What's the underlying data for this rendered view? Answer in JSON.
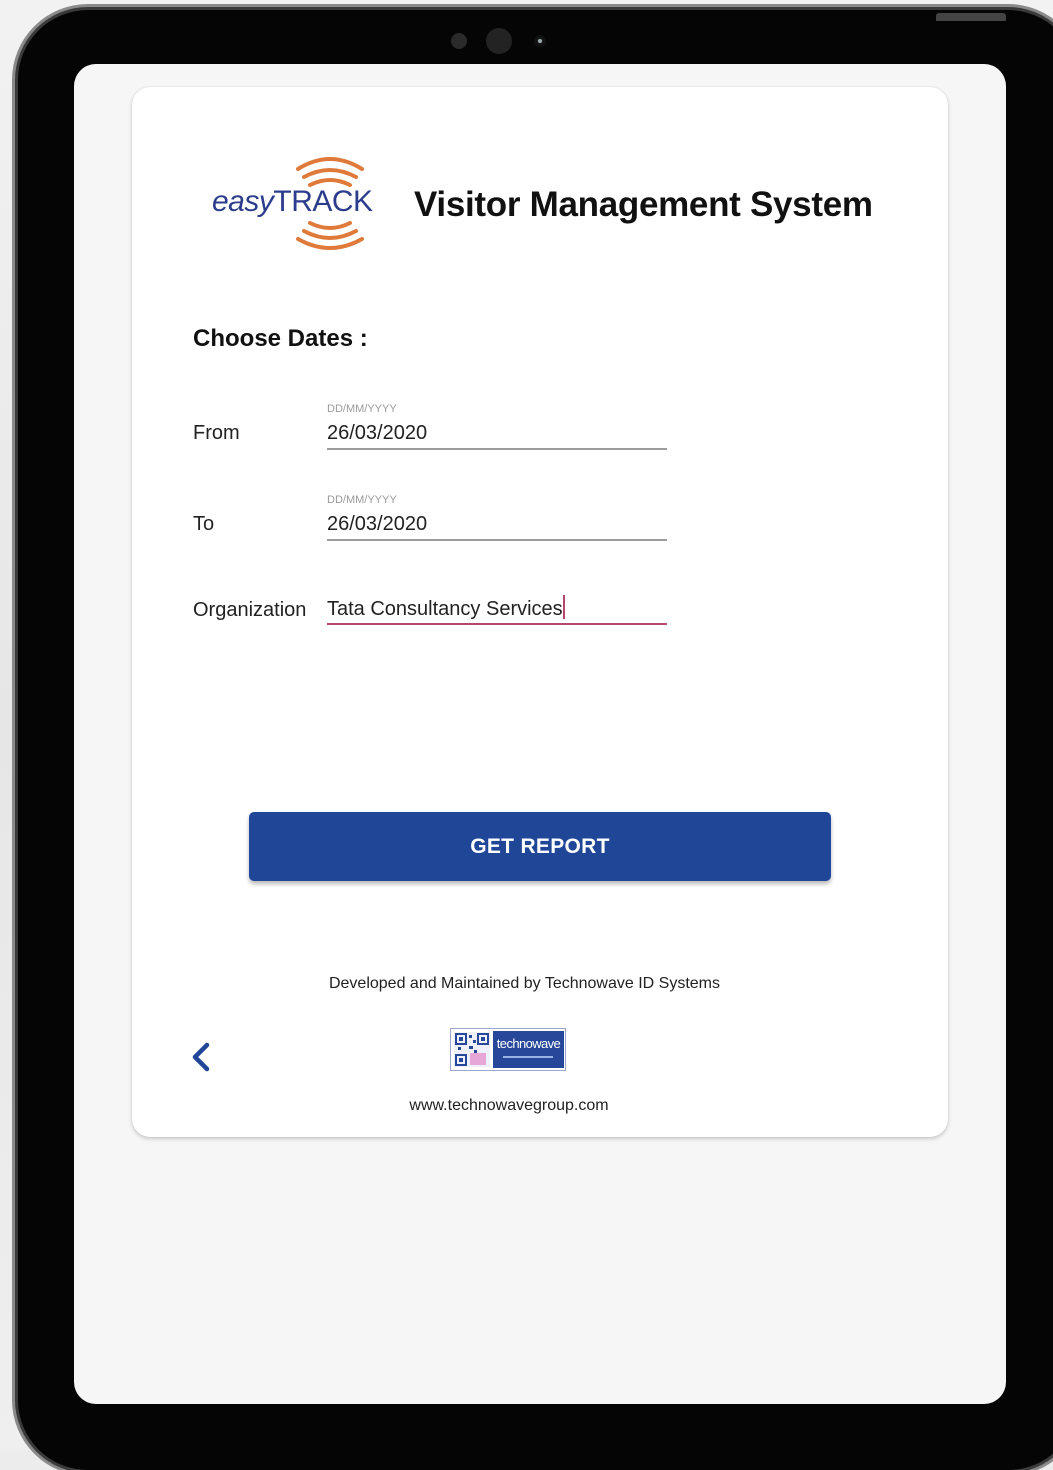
{
  "header": {
    "logo_easy": "easy",
    "logo_track": "TRACK",
    "title": "Visitor Management System"
  },
  "form": {
    "section_title": "Choose Dates :",
    "from": {
      "label": "From",
      "hint": "DD/MM/YYYY",
      "value": "26/03/2020"
    },
    "to": {
      "label": "To",
      "hint": "DD/MM/YYYY",
      "value": "26/03/2020"
    },
    "organization": {
      "label": "Organization",
      "value": "Tata Consultancy Services"
    }
  },
  "actions": {
    "get_report_label": "GET REPORT"
  },
  "footer": {
    "developed_by": "Developed and Maintained by Technowave ID Systems",
    "company_logo_text": "technowave",
    "website": "www.technowavegroup.com"
  },
  "colors": {
    "primary_button": "#1f4697",
    "logo_orange": "#e07a3a",
    "logo_blue": "#2b3c8c",
    "active_underline": "#b5476a"
  },
  "icons": {
    "back": "chevron-left-icon",
    "logo_signal": "signal-arcs-icon"
  }
}
